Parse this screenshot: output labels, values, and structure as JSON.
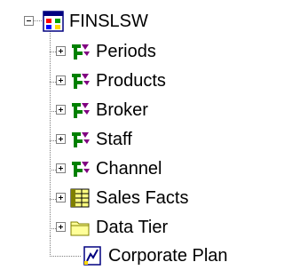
{
  "tree": {
    "root": {
      "label": "FINSLSW",
      "icon": "cube-database-icon",
      "expanded": true
    },
    "children": [
      {
        "label": "Periods",
        "icon": "dimension-hierarchy-icon"
      },
      {
        "label": "Products",
        "icon": "dimension-hierarchy-icon"
      },
      {
        "label": "Broker",
        "icon": "dimension-hierarchy-icon"
      },
      {
        "label": "Staff",
        "icon": "dimension-hierarchy-icon"
      },
      {
        "label": "Channel",
        "icon": "dimension-hierarchy-icon"
      },
      {
        "label": "Sales Facts",
        "icon": "fact-table-icon"
      },
      {
        "label": "Data Tier",
        "icon": "folder-icon"
      },
      {
        "label": "Corporate Plan",
        "icon": "plan-document-icon"
      }
    ]
  }
}
